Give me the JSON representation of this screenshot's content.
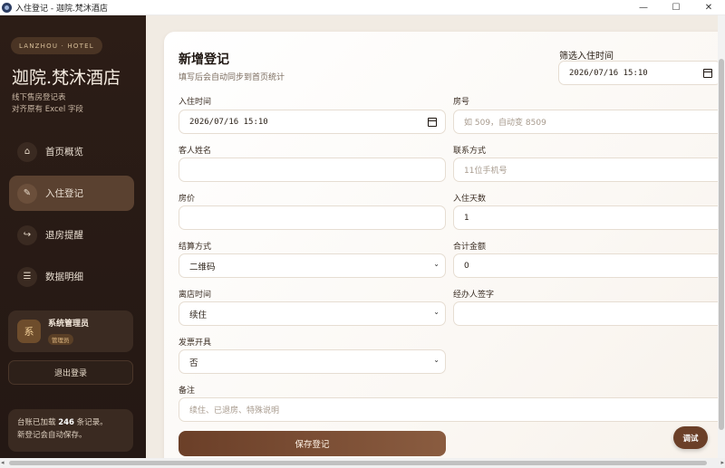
{
  "window": {
    "title": "入住登记 - 迦院.梵沐酒店",
    "controls": [
      "—",
      "☐",
      "✕"
    ]
  },
  "sidebar": {
    "tag": "LANZHOU · HOTEL",
    "hotel_name": "迦院.梵沐酒店",
    "sub_line1": "线下售房登记表",
    "sub_line2": "对齐原有 Excel 字段",
    "items": [
      {
        "label": "首页概览",
        "icon": "home-icon",
        "glyph": "⌂"
      },
      {
        "label": "入住登记",
        "icon": "pen-icon",
        "glyph": "✎"
      },
      {
        "label": "退房提醒",
        "icon": "return-arrow-icon",
        "glyph": "↪"
      },
      {
        "label": "数据明细",
        "icon": "list-icon",
        "glyph": "☰"
      }
    ],
    "user": {
      "avatar": "系",
      "name": "系统管理员",
      "role": "管理员"
    },
    "logout": "退出登录",
    "note_prefix": "台账已加载 ",
    "note_count": "246",
    "note_suffix": " 条记录。",
    "note_line2": "新登记会自动保存。"
  },
  "form": {
    "title": "新增登记",
    "subtitle": "填写后会自动同步到首页统计",
    "filter_label": "筛选入住时间",
    "filter_value": "2026/07/16  15:10",
    "checkin_label": "入住时间",
    "checkin_value": "2026/07/16  15:10",
    "room_label": "房号",
    "room_placeholder": "如 509，自动变 8509",
    "guest_label": "客人姓名",
    "guest_value": "",
    "phone_label": "联系方式",
    "phone_placeholder": "11位手机号",
    "price_label": "房价",
    "price_value": "",
    "days_label": "入住天数",
    "days_value": "1",
    "payment_label": "结算方式",
    "payment_value": "二维码",
    "total_label": "合计金额",
    "total_value": "0",
    "checkout_label": "离店时间",
    "checkout_value": "续住",
    "signer_label": "经办人签字",
    "signer_value": "",
    "invoice_label": "发票开具",
    "invoice_value": "否",
    "remark_label": "备注",
    "remark_placeholder": "续住、已退房、特殊说明",
    "save_label": "保存登记"
  },
  "debug_label": "调试"
}
